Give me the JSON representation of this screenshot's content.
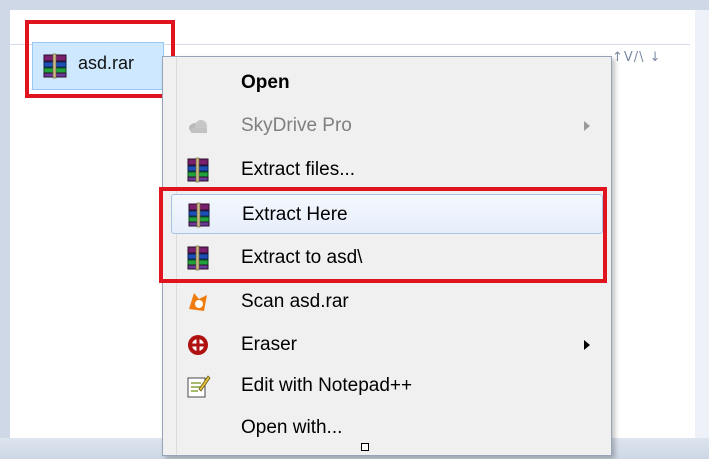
{
  "file": {
    "name": "asd.rar",
    "icon": "winrar-icon"
  },
  "header_hint": "↑V/\\ ↓",
  "menu": {
    "items": [
      {
        "label": "Open",
        "icon": "",
        "bold": true
      },
      {
        "label": "SkyDrive Pro",
        "icon": "cloud-icon",
        "disabled": true,
        "submenu": true
      },
      {
        "label": "Extract files...",
        "icon": "winrar-icon"
      },
      {
        "label": "Extract Here",
        "icon": "winrar-icon",
        "hover": true
      },
      {
        "label": "Extract to asd\\",
        "icon": "winrar-icon"
      },
      {
        "label": "Scan asd.rar",
        "icon": "avast-icon"
      },
      {
        "label": "Eraser",
        "icon": "eraser-icon",
        "submenu": true
      },
      {
        "label": "Edit with Notepad++",
        "icon": "notepad-icon"
      },
      {
        "label": "Open with...",
        "icon": ""
      }
    ]
  },
  "colors": {
    "highlight_box": "#e0141f",
    "selection": "#cde8ff"
  }
}
